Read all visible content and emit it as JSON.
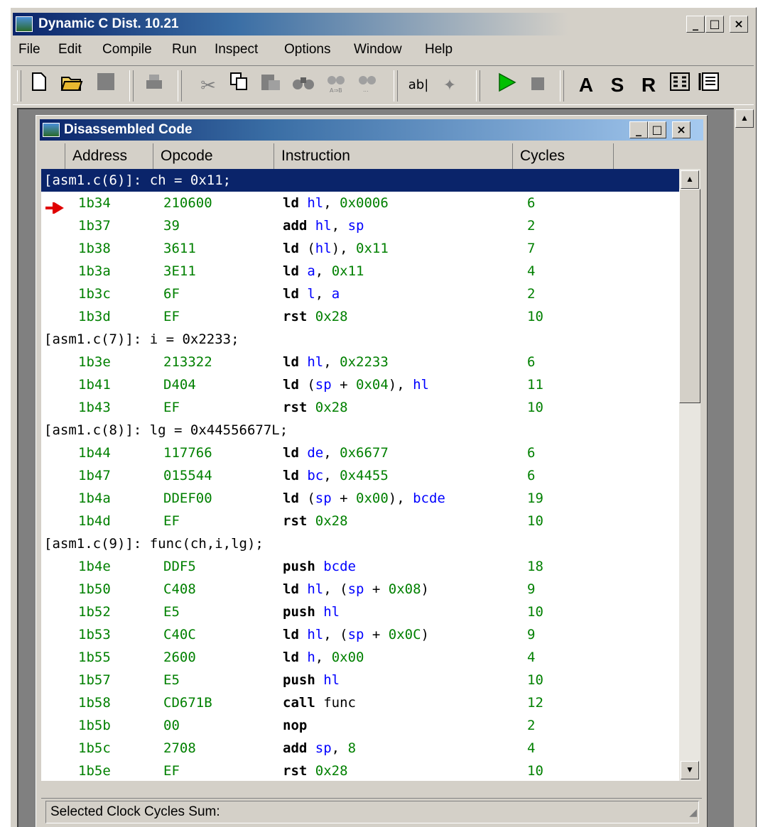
{
  "app": {
    "title": "Dynamic C Dist. 10.21",
    "window_buttons": [
      "_",
      "□",
      "×"
    ]
  },
  "menu": [
    "File",
    "Edit",
    "Compile",
    "Run",
    "Inspect",
    "Options",
    "Window",
    "Help"
  ],
  "toolbar": {
    "icons": [
      "new-file-icon",
      "open-folder-icon",
      "save-icon",
      "print-icon",
      "cut-icon",
      "copy-icon",
      "paste-icon",
      "find-icon",
      "replace-icon",
      "find-next-icon",
      "text-edit-icon",
      "wand-icon",
      "run-icon",
      "stop-icon"
    ],
    "letters": [
      "A",
      "S",
      "R"
    ],
    "extra_icons": [
      "io-registers-icon",
      "stack-icon"
    ],
    "colors": {
      "run": "#00c000",
      "stop": "#808080"
    }
  },
  "child": {
    "title": "Disassembled Code",
    "window_buttons": [
      "_",
      "□",
      "×"
    ],
    "columns": [
      "Address",
      "Opcode",
      "Instruction",
      "Cycles"
    ],
    "status_label": "Selected Clock Cycles Sum:",
    "rows": [
      {
        "type": "source",
        "text": "[asm1.c(6)]: ch = 0x11;",
        "selected": true
      },
      {
        "type": "asm",
        "addr": "1b34",
        "op": "210600",
        "mn": "ld",
        "args": [
          [
            "reg",
            "hl"
          ],
          [
            "sym",
            ", "
          ],
          [
            "num",
            "0x0006"
          ]
        ],
        "cyc": "6",
        "current": true
      },
      {
        "type": "asm",
        "addr": "1b37",
        "op": "39",
        "mn": "add",
        "args": [
          [
            "reg",
            "hl"
          ],
          [
            "sym",
            ", "
          ],
          [
            "reg",
            "sp"
          ]
        ],
        "cyc": "2"
      },
      {
        "type": "asm",
        "addr": "1b38",
        "op": "3611",
        "mn": "ld",
        "args": [
          [
            "sym",
            "("
          ],
          [
            "reg",
            "hl"
          ],
          [
            "sym",
            "), "
          ],
          [
            "num",
            "0x11"
          ]
        ],
        "cyc": "7"
      },
      {
        "type": "asm",
        "addr": "1b3a",
        "op": "3E11",
        "mn": "ld",
        "args": [
          [
            "reg",
            "a"
          ],
          [
            "sym",
            ", "
          ],
          [
            "num",
            "0x11"
          ]
        ],
        "cyc": "4"
      },
      {
        "type": "asm",
        "addr": "1b3c",
        "op": "6F",
        "mn": "ld",
        "args": [
          [
            "reg",
            "l"
          ],
          [
            "sym",
            ", "
          ],
          [
            "reg",
            "a"
          ]
        ],
        "cyc": "2"
      },
      {
        "type": "asm",
        "addr": "1b3d",
        "op": "EF",
        "mn": "rst",
        "args": [
          [
            "num",
            "0x28"
          ]
        ],
        "cyc": "10"
      },
      {
        "type": "source",
        "text": "[asm1.c(7)]: i = 0x2233;"
      },
      {
        "type": "asm",
        "addr": "1b3e",
        "op": "213322",
        "mn": "ld",
        "args": [
          [
            "reg",
            "hl"
          ],
          [
            "sym",
            ", "
          ],
          [
            "num",
            "0x2233"
          ]
        ],
        "cyc": "6"
      },
      {
        "type": "asm",
        "addr": "1b41",
        "op": "D404",
        "mn": "ld",
        "args": [
          [
            "sym",
            "("
          ],
          [
            "reg",
            "sp"
          ],
          [
            "sym",
            " + "
          ],
          [
            "num",
            "0x04"
          ],
          [
            "sym",
            "), "
          ],
          [
            "reg",
            "hl"
          ]
        ],
        "cyc": "11"
      },
      {
        "type": "asm",
        "addr": "1b43",
        "op": "EF",
        "mn": "rst",
        "args": [
          [
            "num",
            "0x28"
          ]
        ],
        "cyc": "10"
      },
      {
        "type": "source",
        "text": "[asm1.c(8)]: lg = 0x44556677L;"
      },
      {
        "type": "asm",
        "addr": "1b44",
        "op": "117766",
        "mn": "ld",
        "args": [
          [
            "reg",
            "de"
          ],
          [
            "sym",
            ", "
          ],
          [
            "num",
            "0x6677"
          ]
        ],
        "cyc": "6"
      },
      {
        "type": "asm",
        "addr": "1b47",
        "op": "015544",
        "mn": "ld",
        "args": [
          [
            "reg",
            "bc"
          ],
          [
            "sym",
            ", "
          ],
          [
            "num",
            "0x4455"
          ]
        ],
        "cyc": "6"
      },
      {
        "type": "asm",
        "addr": "1b4a",
        "op": "DDEF00",
        "mn": "ld",
        "args": [
          [
            "sym",
            "("
          ],
          [
            "reg",
            "sp"
          ],
          [
            "sym",
            " + "
          ],
          [
            "num",
            "0x00"
          ],
          [
            "sym",
            "), "
          ],
          [
            "reg",
            "bcde"
          ]
        ],
        "cyc": "19"
      },
      {
        "type": "asm",
        "addr": "1b4d",
        "op": "EF",
        "mn": "rst",
        "args": [
          [
            "num",
            "0x28"
          ]
        ],
        "cyc": "10"
      },
      {
        "type": "source",
        "text": "[asm1.c(9)]: func(ch,i,lg);"
      },
      {
        "type": "asm",
        "addr": "1b4e",
        "op": "DDF5",
        "mn": "push",
        "args": [
          [
            "reg",
            "bcde"
          ]
        ],
        "cyc": "18"
      },
      {
        "type": "asm",
        "addr": "1b50",
        "op": "C408",
        "mn": "ld",
        "args": [
          [
            "reg",
            "hl"
          ],
          [
            "sym",
            ", ("
          ],
          [
            "reg",
            "sp"
          ],
          [
            "sym",
            " + "
          ],
          [
            "num",
            "0x08"
          ],
          [
            "sym",
            ")"
          ]
        ],
        "cyc": "9"
      },
      {
        "type": "asm",
        "addr": "1b52",
        "op": "E5",
        "mn": "push",
        "args": [
          [
            "reg",
            "hl"
          ]
        ],
        "cyc": "10"
      },
      {
        "type": "asm",
        "addr": "1b53",
        "op": "C40C",
        "mn": "ld",
        "args": [
          [
            "reg",
            "hl"
          ],
          [
            "sym",
            ", ("
          ],
          [
            "reg",
            "sp"
          ],
          [
            "sym",
            " + "
          ],
          [
            "num",
            "0x0C"
          ],
          [
            "sym",
            ")"
          ]
        ],
        "cyc": "9"
      },
      {
        "type": "asm",
        "addr": "1b55",
        "op": "2600",
        "mn": "ld",
        "args": [
          [
            "reg",
            "h"
          ],
          [
            "sym",
            ", "
          ],
          [
            "num",
            "0x00"
          ]
        ],
        "cyc": "4"
      },
      {
        "type": "asm",
        "addr": "1b57",
        "op": "E5",
        "mn": "push",
        "args": [
          [
            "reg",
            "hl"
          ]
        ],
        "cyc": "10"
      },
      {
        "type": "asm",
        "addr": "1b58",
        "op": "CD671B",
        "mn": "call",
        "args": [
          [
            "sym",
            "func"
          ]
        ],
        "cyc": "12"
      },
      {
        "type": "asm",
        "addr": "1b5b",
        "op": "00",
        "mn": "nop",
        "args": [],
        "cyc": "2"
      },
      {
        "type": "asm",
        "addr": "1b5c",
        "op": "2708",
        "mn": "add",
        "args": [
          [
            "reg",
            "sp"
          ],
          [
            "sym",
            ", "
          ],
          [
            "num",
            "8"
          ]
        ],
        "cyc": "4"
      },
      {
        "type": "asm",
        "addr": "1b5e",
        "op": "EF",
        "mn": "rst",
        "args": [
          [
            "num",
            "0x28"
          ]
        ],
        "cyc": "10"
      }
    ]
  }
}
